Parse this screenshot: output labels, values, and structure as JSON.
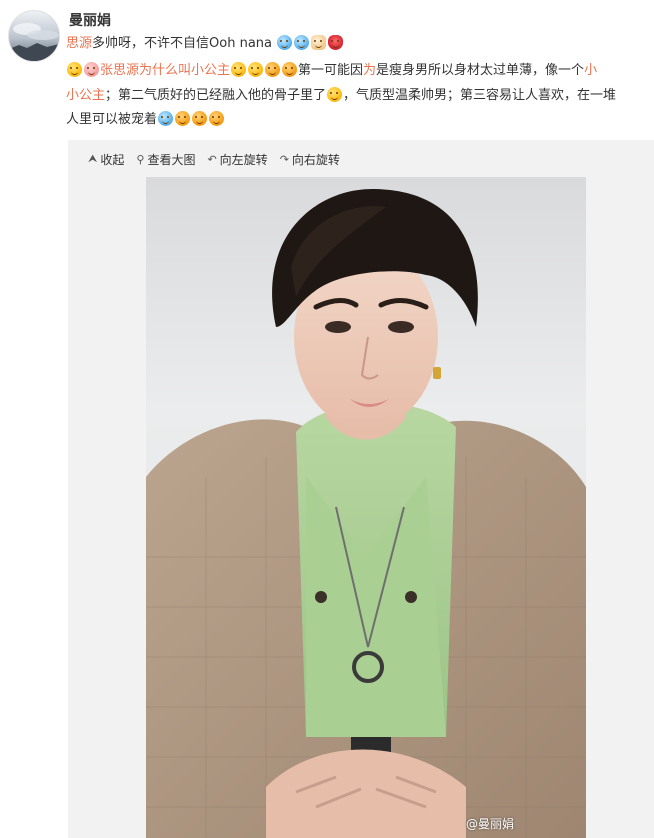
{
  "post": {
    "author": "曼丽娟",
    "line1": {
      "mention": "思源",
      "text": "多帅呀，不许不自信Ooh nana"
    },
    "line2": {
      "link": "张思源为什么叫小公主",
      "text_a": "第一可能因",
      "text_red": "为",
      "text_b": "是瘦身男所以身材太过单薄，像一个",
      "tail_red": "小"
    },
    "line3": {
      "start_red": "小公主",
      "text": "；第二气质好的已经融入他的骨子里了",
      "text_b": "，气质型温柔帅男；第三容易让人喜欢，在一堆"
    },
    "line4": {
      "text": "人里可以被宠着"
    }
  },
  "toolbar": {
    "collapse": "收起",
    "view_large": "查看大图",
    "rotate_left": "向左旋转",
    "rotate_right": "向右旋转"
  },
  "image": {
    "watermark": "@曼丽娟",
    "alt_subject": "portrait-photo"
  },
  "colors": {
    "accent_link": "#eb7350",
    "panel_bg": "#f2f2f2"
  },
  "icons": [
    "collapse-icon",
    "magnifier-icon",
    "rotate-left-icon",
    "rotate-right-icon"
  ]
}
